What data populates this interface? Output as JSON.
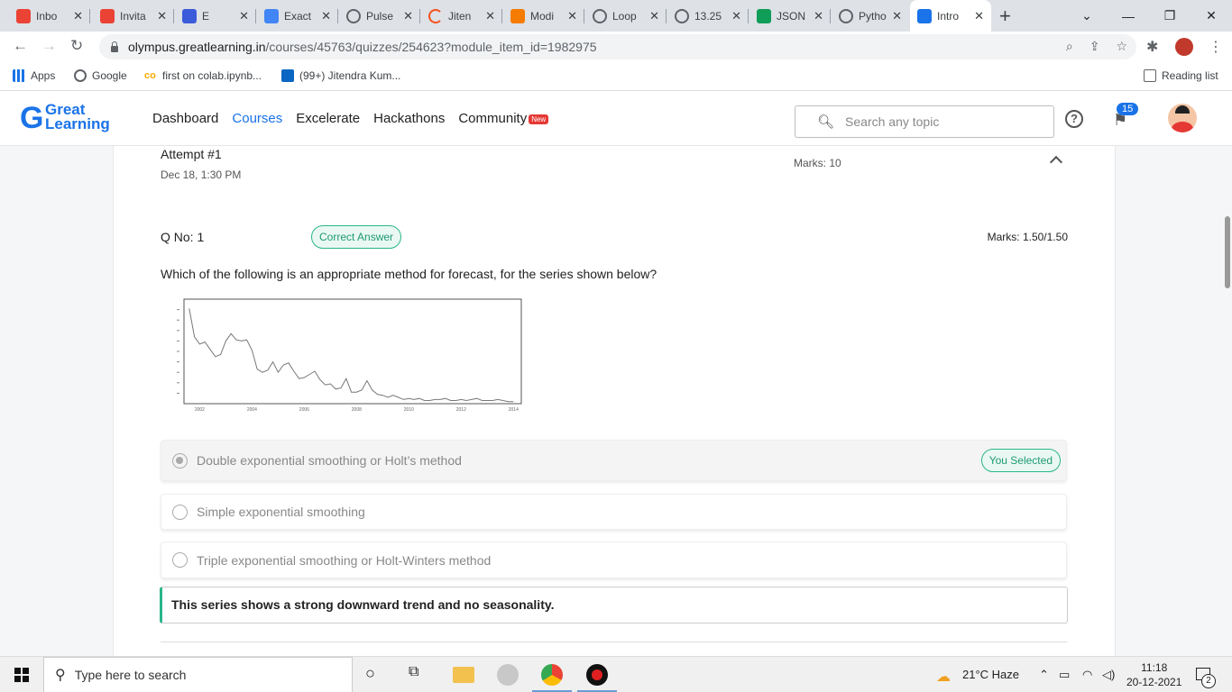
{
  "browser": {
    "tabs": [
      {
        "title": "Inbo",
        "icon": "gmail-icon",
        "color": "#ea4335"
      },
      {
        "title": "Invita",
        "icon": "gmail-icon",
        "color": "#ea4335"
      },
      {
        "title": "E",
        "icon": "recording-icon",
        "color": "#3b5bdb"
      },
      {
        "title": "Exact",
        "icon": "docs-icon",
        "color": "#4285f4"
      },
      {
        "title": "Pulse",
        "icon": "globe-icon",
        "color": "#5f6368"
      },
      {
        "title": "Jiten",
        "icon": "spinner-icon",
        "color": "#f4511e"
      },
      {
        "title": "Modi",
        "icon": "notebook-icon",
        "color": "#f57c00"
      },
      {
        "title": "Loop",
        "icon": "globe-icon",
        "color": "#5f6368"
      },
      {
        "title": "13.25",
        "icon": "globe-icon",
        "color": "#5f6368"
      },
      {
        "title": "JSON",
        "icon": "drive-icon",
        "color": "#0f9d58"
      },
      {
        "title": "Pytho",
        "icon": "globe-icon",
        "color": "#5f6368"
      },
      {
        "title": "Intro",
        "icon": "greatlearning-icon",
        "color": "#1a73e8"
      }
    ],
    "url_host": "olympus.greatlearning.in",
    "url_path": "/courses/45763/quizzes/254623?module_item_id=1982975",
    "bookmarks": [
      {
        "label": "Apps"
      },
      {
        "label": "Google"
      },
      {
        "label": "first on colab.ipynb..."
      },
      {
        "label": "(99+) Jitendra Kum..."
      }
    ],
    "reading_list": "Reading list"
  },
  "site": {
    "logo_line1": "Great",
    "logo_line2": "Learning",
    "nav": [
      "Dashboard",
      "Courses",
      "Excelerate",
      "Hackathons",
      "Community"
    ],
    "new_badge": "New",
    "search_placeholder": "Search any topic",
    "notif_count": "15"
  },
  "attempt": {
    "title": "Attempt #1",
    "date": "Dec 18, 1:30 PM",
    "marks": "Marks: 10"
  },
  "question": {
    "number": "Q No: 1",
    "status": "Correct Answer",
    "marks": "Marks: 1.50/1.50",
    "text": "Which of the following is an appropriate method for forecast, for the series shown below?",
    "options": [
      {
        "label": "Double exponential smoothing or Holt’s method",
        "selected": true,
        "selected_label": "You Selected"
      },
      {
        "label": "Simple exponential smoothing",
        "selected": false
      },
      {
        "label": "Triple exponential smoothing or Holt-Winters method",
        "selected": false
      }
    ],
    "explanation": "This series shows a strong downward trend and no seasonality."
  },
  "chart_data": {
    "type": "line",
    "x_ticks": [
      "2002",
      "2004",
      "2006",
      "2008",
      "2010",
      "2012",
      "2014"
    ],
    "xlim": [
      2001.4,
      2014.3
    ],
    "ylim": [
      0,
      10
    ],
    "series": [
      {
        "x": [
          2001.6,
          2001.8,
          2002.0,
          2002.2,
          2002.4,
          2002.6,
          2002.8,
          2003.0,
          2003.2,
          2003.4,
          2003.6,
          2003.8,
          2004.0,
          2004.2,
          2004.4,
          2004.6,
          2004.8,
          2005.0,
          2005.2,
          2005.4,
          2005.6,
          2005.8,
          2006.0,
          2006.2,
          2006.4,
          2006.6,
          2006.8,
          2007.0,
          2007.2,
          2007.4,
          2007.6,
          2007.8,
          2008.0,
          2008.2,
          2008.4,
          2008.6,
          2008.8,
          2009.0,
          2009.2,
          2009.4,
          2009.6,
          2009.8,
          2010.0,
          2010.2,
          2010.4,
          2010.6,
          2010.8,
          2011.0,
          2011.2,
          2011.4,
          2011.6,
          2011.8,
          2012.0,
          2012.2,
          2012.4,
          2012.6,
          2012.8,
          2013.0,
          2013.2,
          2013.4,
          2013.6,
          2013.8,
          2014.0
        ],
        "y": [
          9.1,
          6.4,
          5.7,
          5.9,
          5.2,
          4.5,
          4.7,
          6.0,
          6.7,
          6.1,
          6.0,
          6.1,
          5.1,
          3.3,
          3.0,
          3.2,
          4.0,
          3.0,
          3.7,
          3.9,
          3.1,
          2.4,
          2.5,
          2.8,
          3.1,
          2.3,
          1.8,
          1.9,
          1.4,
          1.5,
          2.4,
          1.1,
          1.1,
          1.3,
          2.2,
          1.3,
          0.9,
          0.8,
          0.6,
          0.8,
          0.6,
          0.4,
          0.5,
          0.4,
          0.5,
          0.3,
          0.3,
          0.4,
          0.4,
          0.5,
          0.3,
          0.3,
          0.4,
          0.3,
          0.4,
          0.5,
          0.3,
          0.3,
          0.3,
          0.4,
          0.3,
          0.2,
          0.2
        ]
      }
    ]
  },
  "taskbar": {
    "search_placeholder": "Type here to search",
    "weather": "21°C  Haze",
    "time": "11:18",
    "date": "20-12-2021",
    "notifications": "2"
  }
}
